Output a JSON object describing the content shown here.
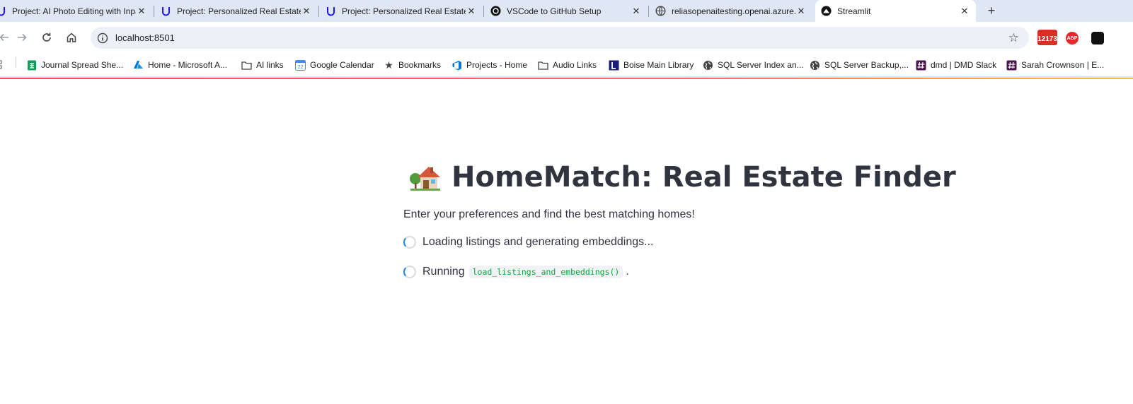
{
  "browser": {
    "tabs": [
      {
        "title": "Project: AI Photo Editing with Inpainting",
        "icon": "udacity-icon"
      },
      {
        "title": "Project: Personalized Real Estate Agent",
        "icon": "udacity-icon"
      },
      {
        "title": "Project: Personalized Real Estate Agent",
        "icon": "udacity-icon"
      },
      {
        "title": "VSCode to GitHub Setup",
        "icon": "openai-icon"
      },
      {
        "title": "reliasopenaitesting.openai.azure.com",
        "icon": "globe-icon"
      },
      {
        "title": "Streamlit",
        "icon": "streamlit-icon",
        "active": true
      }
    ],
    "new_tab_label": "+",
    "close_label": "✕",
    "url": "localhost:8501",
    "extensions": {
      "badge_count": "12173",
      "adblock_label": "ABP"
    },
    "bookmarks": [
      {
        "label": "Journal Spread She...",
        "icon": "sheets-icon"
      },
      {
        "label": "Home - Microsoft A...",
        "icon": "azure-icon"
      },
      {
        "label": "AI links",
        "icon": "folder-icon"
      },
      {
        "label": "Google Calendar",
        "icon": "calendar-icon"
      },
      {
        "label": "Bookmarks",
        "icon": "star-icon"
      },
      {
        "label": "Projects - Home",
        "icon": "azure-devops-icon"
      },
      {
        "label": "Audio Links",
        "icon": "folder-icon"
      },
      {
        "label": "Boise Main Library",
        "icon": "library-icon"
      },
      {
        "label": "SQL Server Index an...",
        "icon": "globe-icon"
      },
      {
        "label": "SQL Server Backup,...",
        "icon": "globe-icon"
      },
      {
        "label": "dmd | DMD Slack",
        "icon": "slack-icon"
      },
      {
        "label": "Sarah Crownson | E...",
        "icon": "slack-icon"
      }
    ]
  },
  "app": {
    "title": "HomeMatch: Real Estate Finder",
    "subtitle": "Enter your preferences and find the best matching homes!",
    "status_loading": "Loading listings and generating embeddings...",
    "status_running_prefix": "Running",
    "status_running_code": "load_listings_and_embeddings()",
    "status_running_suffix": ".",
    "colors": {
      "text": "#31333f",
      "code": "#09ab3b",
      "spinner": "#1c83e1",
      "loadbar": "#ff4b4b"
    }
  }
}
